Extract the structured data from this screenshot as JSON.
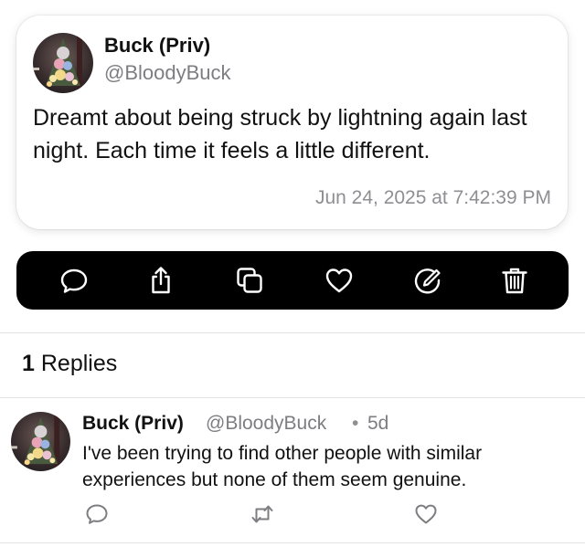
{
  "post": {
    "author_name": "Buck (Priv)",
    "author_handle": "@BloodyBuck",
    "text": "Dreamt about being struck by lightning again last night. Each time it feels a little different.",
    "timestamp": "Jun 24, 2025 at 7:42:39 PM"
  },
  "actions": [
    {
      "name": "comment-icon"
    },
    {
      "name": "share-icon"
    },
    {
      "name": "copy-icon"
    },
    {
      "name": "heart-icon"
    },
    {
      "name": "edit-icon"
    },
    {
      "name": "trash-icon"
    }
  ],
  "replies_section": {
    "count": "1",
    "label": "Replies"
  },
  "reply": {
    "author_name": "Buck (Priv)",
    "author_handle": "@BloodyBuck",
    "separator": "•",
    "age": "5d",
    "text": "I've been trying to find other people with similar experiences but none of them seem genuine.",
    "actions": [
      {
        "name": "comment-icon"
      },
      {
        "name": "repost-icon"
      },
      {
        "name": "heart-icon"
      }
    ]
  },
  "colors": {
    "action_bar": "#000000",
    "secondary_text": "#7d7d82",
    "divider": "#e3e3e6"
  }
}
